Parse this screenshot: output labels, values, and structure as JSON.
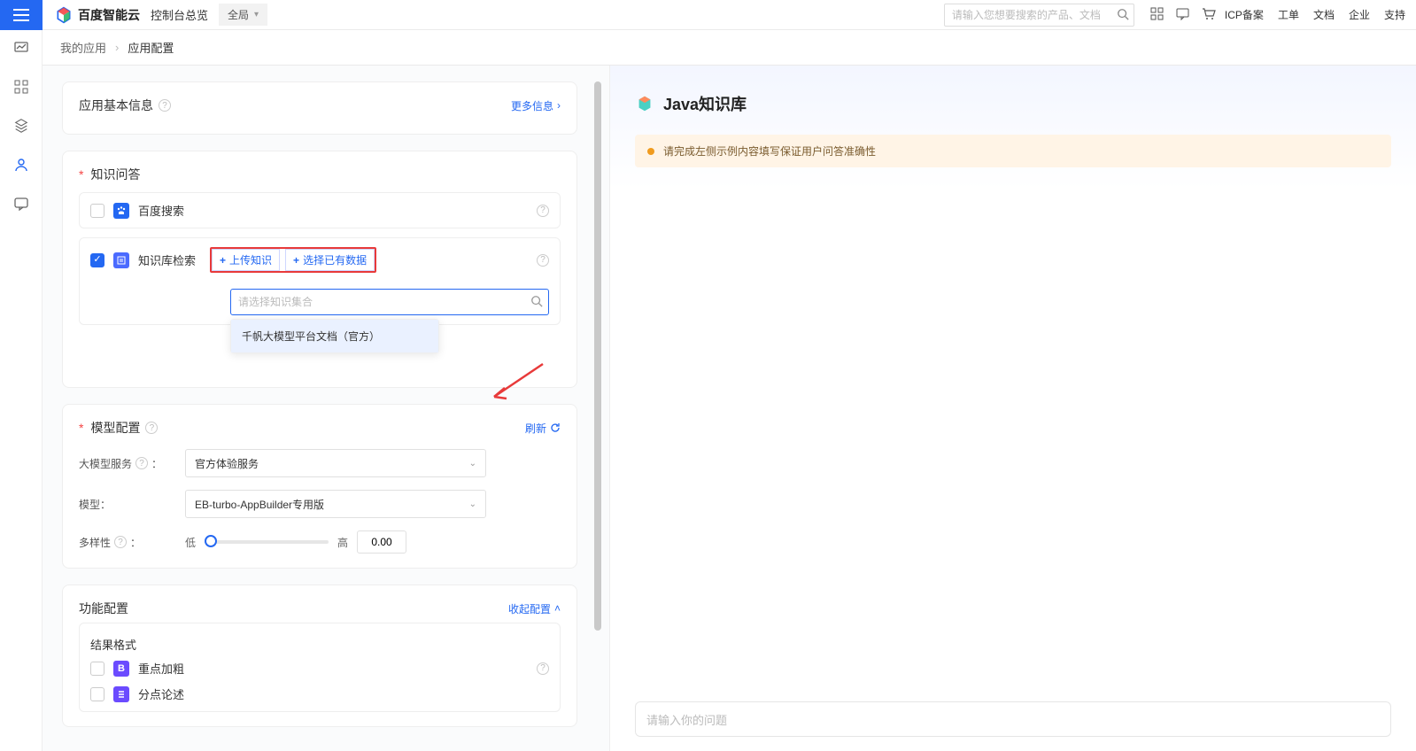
{
  "header": {
    "brand": "百度智能云",
    "console_label": "控制台总览",
    "global_select": "全局",
    "search_placeholder": "请输入您想要搜索的产品、文档",
    "links": [
      "ICP备案",
      "工单",
      "文档",
      "企业",
      "支持"
    ]
  },
  "breadcrumb": {
    "parent": "我的应用",
    "current": "应用配置"
  },
  "basic_info": {
    "title": "应用基本信息",
    "more": "更多信息"
  },
  "qa": {
    "title": "知识问答",
    "baidu_search": "百度搜索",
    "kb_retrieval": "知识库检索",
    "upload_btn": "上传知识",
    "select_existing_btn": "选择已有数据",
    "kb_search_placeholder": "请选择知识集合",
    "kb_option": "千帆大模型平台文档（官方）"
  },
  "model": {
    "title": "模型配置",
    "refresh": "刷新",
    "service_label": "大模型服务",
    "service_value": "官方体验服务",
    "model_label": "模型：",
    "model_value": "EB-turbo-AppBuilder专用版",
    "diversity_label": "多样性",
    "low": "低",
    "high": "高",
    "diversity_value": "0.00"
  },
  "func": {
    "title": "功能配置",
    "collapse": "收起配置",
    "result_format": "结果格式",
    "bold": "重点加粗",
    "points": "分点论述"
  },
  "preview": {
    "title": "Java知识库",
    "notice": "请完成左侧示例内容填写保证用户问答准确性",
    "chat_placeholder": "请输入你的问题"
  }
}
